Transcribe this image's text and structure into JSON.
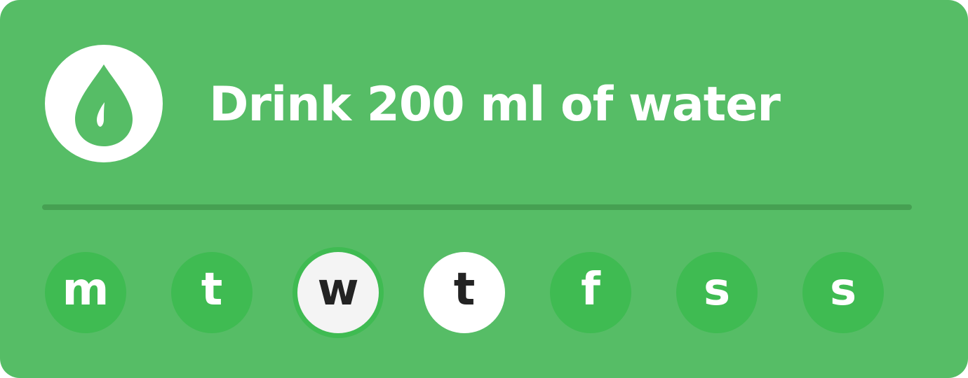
{
  "card": {
    "title": "Drink 200 ml of water",
    "icon": "water-drop-icon",
    "colors": {
      "background": "#56bd66",
      "day_default": "#3fbb52",
      "day_active": "#ffffff",
      "divider": "#46a052"
    }
  },
  "days": [
    {
      "label": "m",
      "state": "default"
    },
    {
      "label": "t",
      "state": "default"
    },
    {
      "label": "w",
      "state": "today"
    },
    {
      "label": "t",
      "state": "selected"
    },
    {
      "label": "f",
      "state": "default"
    },
    {
      "label": "s",
      "state": "default"
    },
    {
      "label": "s",
      "state": "default"
    }
  ]
}
